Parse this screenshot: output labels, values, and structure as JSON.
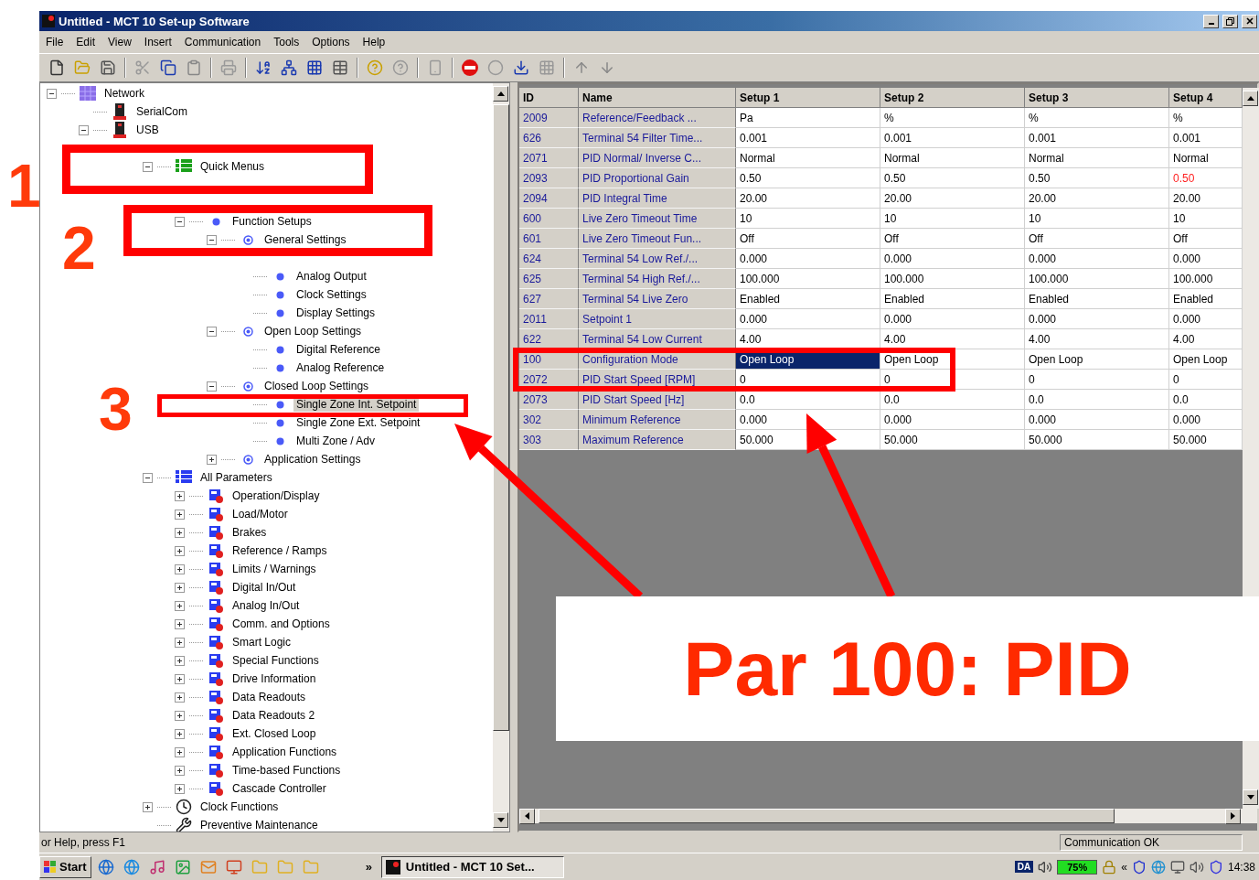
{
  "window": {
    "title": "Untitled - MCT 10 Set-up Software"
  },
  "menu": [
    "File",
    "Edit",
    "View",
    "Insert",
    "Communication",
    "Tools",
    "Options",
    "Help"
  ],
  "tree": [
    {
      "label": "Network",
      "kind": "network",
      "expanded": true,
      "selected": false,
      "children": [
        {
          "label": "SerialCom",
          "kind": "port",
          "selected": false
        },
        {
          "label": "USB",
          "kind": "port",
          "expanded": true,
          "selected": false,
          "children": [
            {
              "children": [
                {
                  "label": "Quick Menus",
                  "kind": "list",
                  "expanded": true,
                  "selected": false,
                  "children": [
                    {
                      "kind": "covered"
                    },
                    {
                      "kind": "covered"
                    },
                    {
                      "label": "Function Setups",
                      "kind": "dot",
                      "expanded": true,
                      "selected": false,
                      "children": [
                        {
                          "label": "General Settings",
                          "kind": "ring",
                          "expanded": true,
                          "selected": false,
                          "children": [
                            {
                              "kind": "covered"
                            },
                            {
                              "label": "Analog Output",
                              "kind": "dot",
                              "selected": false
                            },
                            {
                              "label": "Clock Settings",
                              "kind": "dot",
                              "selected": false
                            },
                            {
                              "label": "Display Settings",
                              "kind": "dot",
                              "selected": false
                            }
                          ]
                        },
                        {
                          "label": "Open Loop Settings",
                          "kind": "ring",
                          "expanded": true,
                          "selected": false,
                          "children": [
                            {
                              "label": "Digital Reference",
                              "kind": "dot",
                              "selected": false
                            },
                            {
                              "label": "Analog Reference",
                              "kind": "dot",
                              "selected": false
                            }
                          ]
                        },
                        {
                          "label": "Closed Loop Settings",
                          "kind": "ring",
                          "expanded": true,
                          "selected": false,
                          "children": [
                            {
                              "label": "Single Zone Int. Setpoint",
                              "kind": "dot",
                              "selected": true
                            },
                            {
                              "label": "Single Zone Ext. Setpoint",
                              "kind": "dot",
                              "selected": false
                            },
                            {
                              "label": "Multi Zone / Adv",
                              "kind": "dot",
                              "selected": false
                            }
                          ]
                        },
                        {
                          "label": "Application Settings",
                          "kind": "ring",
                          "expanded": false,
                          "selected": false
                        }
                      ]
                    }
                  ]
                },
                {
                  "label": "All Parameters",
                  "kind": "list-blue",
                  "expanded": true,
                  "selected": false,
                  "children": [
                    {
                      "label": "Operation/Display",
                      "kind": "group",
                      "expanded": false,
                      "selected": false
                    },
                    {
                      "label": "Load/Motor",
                      "kind": "group",
                      "expanded": false,
                      "selected": false
                    },
                    {
                      "label": "Brakes",
                      "kind": "group",
                      "expanded": false,
                      "selected": false
                    },
                    {
                      "label": "Reference / Ramps",
                      "kind": "group",
                      "expanded": false,
                      "selected": false
                    },
                    {
                      "label": "Limits / Warnings",
                      "kind": "group",
                      "expanded": false,
                      "selected": false
                    },
                    {
                      "label": "Digital In/Out",
                      "kind": "group",
                      "expanded": false,
                      "selected": false
                    },
                    {
                      "label": "Analog In/Out",
                      "kind": "group",
                      "expanded": false,
                      "selected": false
                    },
                    {
                      "label": "Comm. and Options",
                      "kind": "group",
                      "expanded": false,
                      "selected": false
                    },
                    {
                      "label": "Smart Logic",
                      "kind": "group",
                      "expanded": false,
                      "selected": false
                    },
                    {
                      "label": "Special Functions",
                      "kind": "group",
                      "expanded": false,
                      "selected": false
                    },
                    {
                      "label": "Drive Information",
                      "kind": "group",
                      "expanded": false,
                      "selected": false
                    },
                    {
                      "label": "Data Readouts",
                      "kind": "group",
                      "expanded": false,
                      "selected": false
                    },
                    {
                      "label": "Data Readouts 2",
                      "kind": "group",
                      "expanded": false,
                      "selected": false
                    },
                    {
                      "label": "Ext. Closed Loop",
                      "kind": "group",
                      "expanded": false,
                      "selected": false
                    },
                    {
                      "label": "Application Functions",
                      "kind": "group",
                      "expanded": false,
                      "selected": false
                    },
                    {
                      "label": "Time-based Functions",
                      "kind": "group",
                      "expanded": false,
                      "selected": false
                    },
                    {
                      "label": "Cascade Controller",
                      "kind": "group",
                      "expanded": false,
                      "selected": false
                    }
                  ]
                },
                {
                  "label": "Clock Functions",
                  "kind": "clock",
                  "expanded": false,
                  "selected": false
                },
                {
                  "label": "Preventive Maintenance",
                  "kind": "tool",
                  "selected": false
                }
              ]
            }
          ]
        }
      ]
    }
  ],
  "table": {
    "columns": [
      "ID",
      "Name",
      "Setup 1",
      "Setup 2",
      "Setup 3",
      "Setup 4"
    ],
    "rows": [
      {
        "cells": [
          {
            "text": "2009",
            "selected": false,
            "modified": false
          },
          {
            "text": "Reference/Feedback ...",
            "selected": false,
            "modified": false
          },
          {
            "text": "Pa",
            "selected": false,
            "modified": false
          },
          {
            "text": "%",
            "selected": false,
            "modified": false
          },
          {
            "text": "%",
            "selected": false,
            "modified": false
          },
          {
            "text": "%",
            "selected": false,
            "modified": false
          }
        ]
      },
      {
        "cells": [
          {
            "text": "626",
            "selected": false,
            "modified": false
          },
          {
            "text": "Terminal 54 Filter Time...",
            "selected": false,
            "modified": false
          },
          {
            "text": "0.001",
            "selected": false,
            "modified": false
          },
          {
            "text": "0.001",
            "selected": false,
            "modified": false
          },
          {
            "text": "0.001",
            "selected": false,
            "modified": false
          },
          {
            "text": "0.001",
            "selected": false,
            "modified": false
          }
        ]
      },
      {
        "cells": [
          {
            "text": "2071",
            "selected": false,
            "modified": false
          },
          {
            "text": "PID Normal/ Inverse C...",
            "selected": false,
            "modified": false
          },
          {
            "text": "Normal",
            "selected": false,
            "modified": false
          },
          {
            "text": "Normal",
            "selected": false,
            "modified": false
          },
          {
            "text": "Normal",
            "selected": false,
            "modified": false
          },
          {
            "text": "Normal",
            "selected": false,
            "modified": false
          }
        ]
      },
      {
        "cells": [
          {
            "text": "2093",
            "selected": false,
            "modified": false
          },
          {
            "text": "PID Proportional Gain",
            "selected": false,
            "modified": false
          },
          {
            "text": "0.50",
            "selected": false,
            "modified": false
          },
          {
            "text": "0.50",
            "selected": false,
            "modified": false
          },
          {
            "text": "0.50",
            "selected": false,
            "modified": false
          },
          {
            "text": "0.50",
            "selected": false,
            "modified": true
          }
        ]
      },
      {
        "cells": [
          {
            "text": "2094",
            "selected": false,
            "modified": false
          },
          {
            "text": "PID Integral Time",
            "selected": false,
            "modified": false
          },
          {
            "text": "20.00",
            "selected": false,
            "modified": false
          },
          {
            "text": "20.00",
            "selected": false,
            "modified": false
          },
          {
            "text": "20.00",
            "selected": false,
            "modified": false
          },
          {
            "text": "20.00",
            "selected": false,
            "modified": false
          }
        ]
      },
      {
        "cells": [
          {
            "text": "600",
            "selected": false,
            "modified": false
          },
          {
            "text": "Live Zero Timeout Time",
            "selected": false,
            "modified": false
          },
          {
            "text": "10",
            "selected": false,
            "modified": false
          },
          {
            "text": "10",
            "selected": false,
            "modified": false
          },
          {
            "text": "10",
            "selected": false,
            "modified": false
          },
          {
            "text": "10",
            "selected": false,
            "modified": false
          }
        ]
      },
      {
        "cells": [
          {
            "text": "601",
            "selected": false,
            "modified": false
          },
          {
            "text": "Live Zero Timeout Fun...",
            "selected": false,
            "modified": false
          },
          {
            "text": "Off",
            "selected": false,
            "modified": false
          },
          {
            "text": "Off",
            "selected": false,
            "modified": false
          },
          {
            "text": "Off",
            "selected": false,
            "modified": false
          },
          {
            "text": "Off",
            "selected": false,
            "modified": false
          }
        ]
      },
      {
        "cells": [
          {
            "text": "624",
            "selected": false,
            "modified": false
          },
          {
            "text": "Terminal 54 Low Ref./...",
            "selected": false,
            "modified": false
          },
          {
            "text": "0.000",
            "selected": false,
            "modified": false
          },
          {
            "text": "0.000",
            "selected": false,
            "modified": false
          },
          {
            "text": "0.000",
            "selected": false,
            "modified": false
          },
          {
            "text": "0.000",
            "selected": false,
            "modified": false
          }
        ]
      },
      {
        "cells": [
          {
            "text": "625",
            "selected": false,
            "modified": false
          },
          {
            "text": "Terminal 54 High Ref./...",
            "selected": false,
            "modified": false
          },
          {
            "text": "100.000",
            "selected": false,
            "modified": false
          },
          {
            "text": "100.000",
            "selected": false,
            "modified": false
          },
          {
            "text": "100.000",
            "selected": false,
            "modified": false
          },
          {
            "text": "100.000",
            "selected": false,
            "modified": false
          }
        ]
      },
      {
        "cells": [
          {
            "text": "627",
            "selected": false,
            "modified": false
          },
          {
            "text": "Terminal 54 Live Zero",
            "selected": false,
            "modified": false
          },
          {
            "text": "Enabled",
            "selected": false,
            "modified": false
          },
          {
            "text": "Enabled",
            "selected": false,
            "modified": false
          },
          {
            "text": "Enabled",
            "selected": false,
            "modified": false
          },
          {
            "text": "Enabled",
            "selected": false,
            "modified": false
          }
        ]
      },
      {
        "cells": [
          {
            "text": "2011",
            "selected": false,
            "modified": false
          },
          {
            "text": "Setpoint 1",
            "selected": false,
            "modified": false
          },
          {
            "text": "0.000",
            "selected": false,
            "modified": false
          },
          {
            "text": "0.000",
            "selected": false,
            "modified": false
          },
          {
            "text": "0.000",
            "selected": false,
            "modified": false
          },
          {
            "text": "0.000",
            "selected": false,
            "modified": false
          }
        ]
      },
      {
        "cells": [
          {
            "text": "622",
            "selected": false,
            "modified": false
          },
          {
            "text": "Terminal 54 Low Current",
            "selected": false,
            "modified": false
          },
          {
            "text": "4.00",
            "selected": false,
            "modified": false
          },
          {
            "text": "4.00",
            "selected": false,
            "modified": false
          },
          {
            "text": "4.00",
            "selected": false,
            "modified": false
          },
          {
            "text": "4.00",
            "selected": false,
            "modified": false
          }
        ]
      },
      {
        "cells": [
          {
            "text": "100",
            "selected": false,
            "modified": false
          },
          {
            "text": "Configuration Mode",
            "selected": false,
            "modified": false
          },
          {
            "text": "Open Loop",
            "selected": true,
            "modified": false
          },
          {
            "text": "Open Loop",
            "selected": false,
            "modified": false
          },
          {
            "text": "Open Loop",
            "selected": false,
            "modified": false
          },
          {
            "text": "Open Loop",
            "selected": false,
            "modified": false
          }
        ]
      },
      {
        "cells": [
          {
            "text": "2072",
            "selected": false,
            "modified": false
          },
          {
            "text": "PID Start Speed [RPM]",
            "selected": false,
            "modified": false
          },
          {
            "text": "0",
            "selected": false,
            "modified": false
          },
          {
            "text": "0",
            "selected": false,
            "modified": false
          },
          {
            "text": "0",
            "selected": false,
            "modified": false
          },
          {
            "text": "0",
            "selected": false,
            "modified": false
          }
        ]
      },
      {
        "cells": [
          {
            "text": "2073",
            "selected": false,
            "modified": false
          },
          {
            "text": "PID Start Speed [Hz]",
            "selected": false,
            "modified": false
          },
          {
            "text": "0.0",
            "selected": false,
            "modified": false
          },
          {
            "text": "0.0",
            "selected": false,
            "modified": false
          },
          {
            "text": "0.0",
            "selected": false,
            "modified": false
          },
          {
            "text": "0.0",
            "selected": false,
            "modified": false
          }
        ]
      },
      {
        "cells": [
          {
            "text": "302",
            "selected": false,
            "modified": false
          },
          {
            "text": "Minimum Reference",
            "selected": false,
            "modified": false
          },
          {
            "text": "0.000",
            "selected": false,
            "modified": false
          },
          {
            "text": "0.000",
            "selected": false,
            "modified": false
          },
          {
            "text": "0.000",
            "selected": false,
            "modified": false
          },
          {
            "text": "0.000",
            "selected": false,
            "modified": false
          }
        ]
      },
      {
        "cells": [
          {
            "text": "303",
            "selected": false,
            "modified": false
          },
          {
            "text": "Maximum Reference",
            "selected": false,
            "modified": false
          },
          {
            "text": "50.000",
            "selected": false,
            "modified": false
          },
          {
            "text": "50.000",
            "selected": false,
            "modified": false
          },
          {
            "text": "50.000",
            "selected": false,
            "modified": false
          },
          {
            "text": "50.000",
            "selected": false,
            "modified": false
          }
        ]
      }
    ]
  },
  "status_bar": {
    "hint": "or Help, press F1",
    "connection": "Communication OK"
  },
  "taskbar": {
    "start": "Start",
    "more": "»",
    "task": "Untitled - MCT 10 Set...",
    "tray_badge": "DA",
    "battery": "75%",
    "tray_more": "«",
    "clock": "14:38"
  },
  "annotations": {
    "steps": [
      "1",
      "2",
      "3"
    ],
    "callout": "Par 100: PID"
  }
}
